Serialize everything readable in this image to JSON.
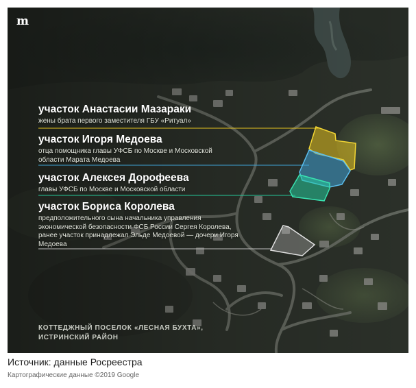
{
  "brand": {
    "logo_glyph": "m",
    "logo_icon": "meduza-logo-icon"
  },
  "plots": [
    {
      "title": "участок Анастасии Мазараки",
      "description": "жены брата первого заместителя ГБУ «Ритуал»",
      "color": "#e5c31f"
    },
    {
      "title": "участок Игоря Медоева",
      "description": "отца помощника главы УФСБ по Москве и Московской области Марата Медоева",
      "color": "#3fa3d6"
    },
    {
      "title": "участок Алексея Дорофеева",
      "description": "главы УФСБ по Москве и Московской области",
      "color": "#25c99a"
    },
    {
      "title": "участок Бориса Королева",
      "description": "предположительного сына начальника управления экономической безопасности ФСБ России Сергея Королева, ранее участок принадлежал Эльде Медоевой — дочери Игоря Медоева",
      "color": "#bdbdbd"
    }
  ],
  "settlement_label": "КОТТЕДЖНЫЙ ПОСЕЛОК «ЛЕСНАЯ БУХТА», ИСТРИНСКИЙ РАЙОН",
  "source": "Источник: данные Росреестра",
  "map_credit": "Картографические данные ©2019 Google"
}
